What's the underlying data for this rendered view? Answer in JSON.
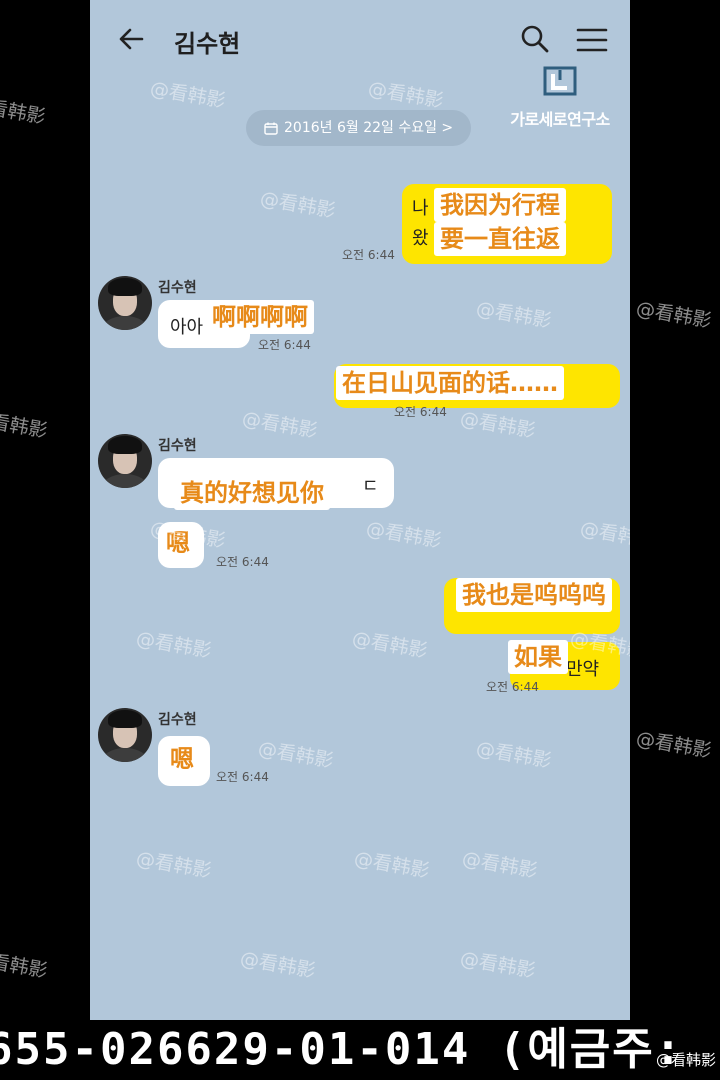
{
  "header": {
    "title": "김수현",
    "logo_text": "가로세로연구소"
  },
  "date_pill": "2016년 6월 22일 수요일 >",
  "messages": [
    {
      "side": "out",
      "original": [
        "나",
        "왔"
      ],
      "subtitle": [
        "我因为行程",
        "要一直往返"
      ],
      "time": "오전 6:44"
    },
    {
      "side": "in",
      "sender": "김수현",
      "original": "아아",
      "subtitle": "啊啊啊啊",
      "time": "오전 6:44"
    },
    {
      "side": "out",
      "subtitle": "在日山见面的话……",
      "time": "오전 6:44"
    },
    {
      "side": "in",
      "sender": "김수현",
      "original": "ㄷ",
      "subtitle": "真的好想见你",
      "subtitle2": "嗯",
      "time": "오전 6:44"
    },
    {
      "side": "out",
      "subtitle": "我也是呜呜呜",
      "subtitle2": "如果",
      "original2": "만약",
      "time": "오전 6:44"
    },
    {
      "side": "in",
      "sender": "김수현",
      "subtitle": "嗯",
      "time": "오전 6:44"
    }
  ],
  "watermark": "@看韩影",
  "ticker": "655-026629-01-014 (예금주:",
  "credit": "@看韩影",
  "colors": {
    "chat_bg": "#b2c7da",
    "my_bubble": "#fee500",
    "subtitle_text": "#e78a19"
  }
}
